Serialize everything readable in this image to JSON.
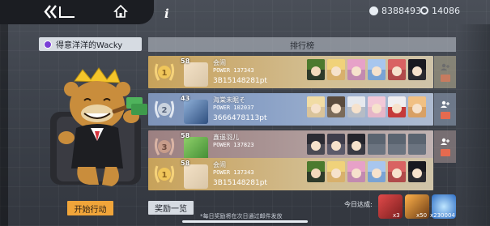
{
  "header": {
    "currency_1": {
      "icon": "crystal-icon",
      "value": "8388493"
    },
    "currency_2": {
      "icon": "ring-token-icon",
      "value": "14086"
    }
  },
  "player": {
    "name": "得意洋洋的Wacky",
    "action_button": "开始行动"
  },
  "ranking": {
    "title": "排行榜",
    "rows": [
      {
        "rank": "1",
        "level": "58",
        "name": "会闹",
        "power": "POWER 137343",
        "score": "3B15148281pt",
        "tier": "gold"
      },
      {
        "rank": "2",
        "level": "43",
        "name": "海棠未眠そ",
        "power": "POWER 102037",
        "score": "3666478113pt",
        "tier": "silver"
      },
      {
        "rank": "3",
        "level": "58",
        "name": "鑫遥羽儿",
        "power": "POWER 137823",
        "score": "",
        "tier": "bronze"
      },
      {
        "rank": "1",
        "level": "58",
        "name": "会闹",
        "power": "POWER 137343",
        "score": "3B15148281pt",
        "tier": "gold"
      }
    ]
  },
  "footer": {
    "reward_button": "奖励一览",
    "note": "*每日奖励将在次日通过邮件发放",
    "today_label": "今日达成:",
    "rewards": [
      {
        "icon": "ticket-icon",
        "count": "x3"
      },
      {
        "icon": "cube-icon",
        "count": "x50"
      },
      {
        "icon": "crystal-icon",
        "count": "x230004"
      }
    ]
  },
  "colors": {
    "gold_row": "#c7a25a",
    "silver_row": "#7d93b8",
    "bronze_row": "#9c8081",
    "accent_orange": "#f0a53a"
  }
}
